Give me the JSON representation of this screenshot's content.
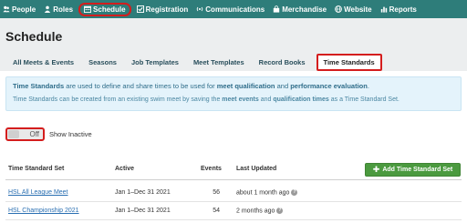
{
  "nav": {
    "items": [
      {
        "label": "People",
        "icon": "people-icon"
      },
      {
        "label": "Roles",
        "icon": "roles-icon"
      },
      {
        "label": "Schedule",
        "icon": "calendar-icon",
        "active": true
      },
      {
        "label": "Registration",
        "icon": "checkbox-icon"
      },
      {
        "label": "Communications",
        "icon": "broadcast-icon"
      },
      {
        "label": "Merchandise",
        "icon": "shopping-bag-icon"
      },
      {
        "label": "Website",
        "icon": "globe-icon"
      },
      {
        "label": "Reports",
        "icon": "bar-chart-icon"
      }
    ]
  },
  "page": {
    "title": "Schedule"
  },
  "tabs": [
    {
      "label": "All Meets & Events"
    },
    {
      "label": "Seasons"
    },
    {
      "label": "Job Templates"
    },
    {
      "label": "Meet Templates"
    },
    {
      "label": "Record Books"
    },
    {
      "label": "Time Standards",
      "active": true
    }
  ],
  "info": {
    "l1_a": "Time Standards",
    "l1_b": " are used to define and share times to be used for ",
    "l1_c": "meet qualification",
    "l1_d": " and ",
    "l1_e": "performance evaluation",
    "l1_f": ".",
    "l2_a": "Time Standards can be created from an existing swim meet by saving the ",
    "l2_b": "meet events",
    "l2_c": " and ",
    "l2_d": "qualification times",
    "l2_e": " as a Time Standard Set."
  },
  "toggle": {
    "value": "Off",
    "label": "Show Inactive"
  },
  "table": {
    "headers": {
      "set": "Time Standard Set",
      "active": "Active",
      "events": "Events",
      "updated": "Last Updated"
    },
    "add_button": "Add Time Standard Set",
    "rows": [
      {
        "name": "HSL All League Meet",
        "active": "Jan 1–Dec 31 2021",
        "events": "56",
        "updated": "about 1 month ago"
      },
      {
        "name": "HSL Championship 2021",
        "active": "Jan 1–Dec 31 2021",
        "events": "54",
        "updated": "2 months ago"
      }
    ]
  },
  "colors": {
    "nav_bg": "#2e7d7a",
    "highlight": "#d41d1d",
    "button_green": "#4b9a3f",
    "link": "#2a6fb2",
    "info_bg": "#e4f3fb"
  }
}
